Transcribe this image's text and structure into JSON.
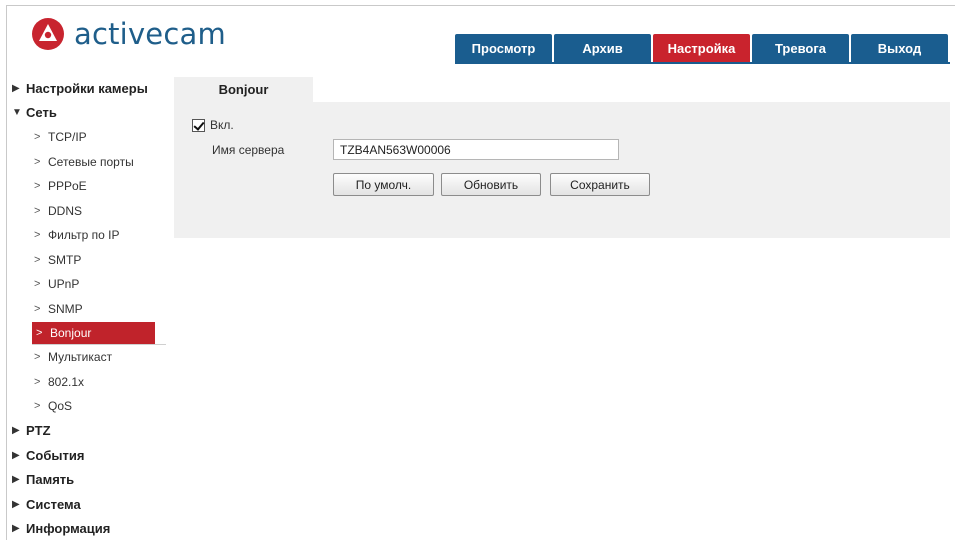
{
  "brand": {
    "name": "activecam",
    "logo_icon": "activecam-logo-icon",
    "accent_color": "#c8242f",
    "primary_color": "#1a5d8f"
  },
  "topnav": {
    "tabs": [
      {
        "label": "Просмотр",
        "active": false
      },
      {
        "label": "Архив",
        "active": false
      },
      {
        "label": "Настройка",
        "active": true
      },
      {
        "label": "Тревога",
        "active": false
      },
      {
        "label": "Выход",
        "active": false
      }
    ]
  },
  "sidebar": {
    "sections": [
      {
        "label": "Настройки камеры",
        "expanded": false
      },
      {
        "label": "Сеть",
        "expanded": true,
        "items": [
          {
            "label": "TCP/IP"
          },
          {
            "label": "Сетевые порты"
          },
          {
            "label": "PPPoE"
          },
          {
            "label": "DDNS"
          },
          {
            "label": "Фильтр по IP"
          },
          {
            "label": "SMTP"
          },
          {
            "label": "UPnP"
          },
          {
            "label": "SNMP"
          },
          {
            "label": "Bonjour",
            "active": true
          },
          {
            "label": "Мультикаст"
          },
          {
            "label": "802.1x"
          },
          {
            "label": "QoS"
          }
        ]
      },
      {
        "label": "PTZ",
        "expanded": false
      },
      {
        "label": "События",
        "expanded": false
      },
      {
        "label": "Память",
        "expanded": false
      },
      {
        "label": "Система",
        "expanded": false
      },
      {
        "label": "Информация",
        "expanded": false
      }
    ]
  },
  "main": {
    "tab_title": "Bonjour",
    "enable_label": "Вкл.",
    "enable_checked": true,
    "server_name_label": "Имя сервера",
    "server_name_value": "TZB4AN563W00006",
    "buttons": {
      "default": "По умолч.",
      "refresh": "Обновить",
      "save": "Сохранить"
    }
  }
}
